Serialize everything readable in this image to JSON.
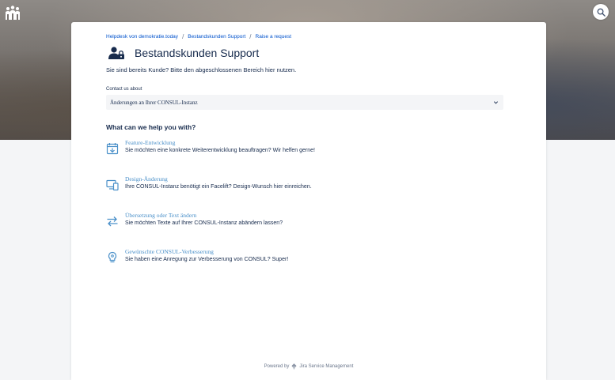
{
  "header": {
    "logo_icon": "people-group-logo-icon",
    "search_icon": "search-icon"
  },
  "breadcrumb": {
    "items": [
      "Helpdesk von demokratie.today",
      "Bestandskunden Support",
      "Raise a request"
    ],
    "separator": "/"
  },
  "portal": {
    "title": "Bestandskunden Support",
    "icon": "user-lock-icon",
    "intro": "Sie sind bereits Kunde? Bitte den abgeschlossenen Bereich hier nutzen."
  },
  "contact": {
    "label": "Contact us about",
    "selected": "Änderungen an Ihrer CONSUL-Instanz"
  },
  "help_heading": "What can we help you with?",
  "request_types": [
    {
      "name": "Feature-Entwicklung",
      "description": "Sie möchten eine konkrete Weiterentwicklung beauftragen? Wir helfen gerne!",
      "icon": "calendar-add-icon"
    },
    {
      "name": "Design-Änderung",
      "description": "Ihre CONSUL-Instanz benötigt ein Facelift? Design-Wunsch hier einreichen.",
      "icon": "devices-icon"
    },
    {
      "name": "Übersetzung oder Text ändern",
      "description": "Sie möchten Texte auf Ihrer CONSUL-Instanz abändern lassen?",
      "icon": "swap-arrows-icon"
    },
    {
      "name": "Gewünschte CONSUL-Verbesserung",
      "description": "Sie haben eine Anregung zur Verbesserung von CONSUL? Super!",
      "icon": "lightbulb-icon"
    }
  ],
  "footer": {
    "prefix": "Powered by",
    "product": "Jira Service Management"
  },
  "colors": {
    "link": "#0052cc",
    "request_name": "#4a90c9",
    "text": "#172b4d",
    "icon": "#4a90c9"
  }
}
